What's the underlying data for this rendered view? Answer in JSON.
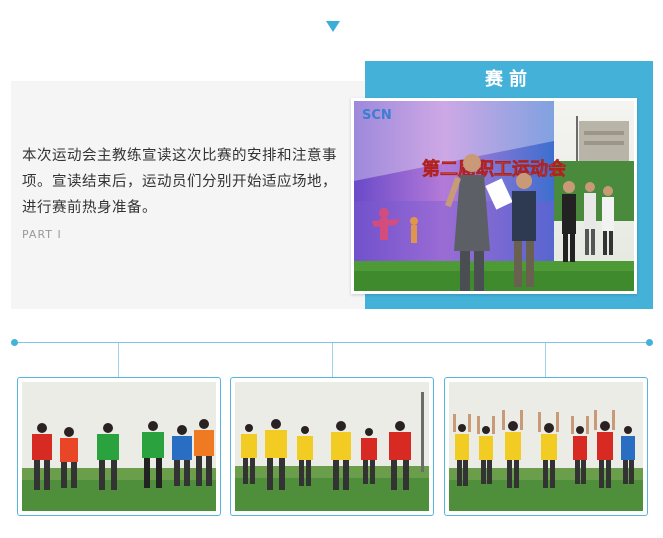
{
  "section": {
    "title": "赛前",
    "description": "本次运动会主教练宣读这次比赛的安排和注意事项。宣读结束后，运动员们分别开始适应场地，进行赛前热身准备。",
    "part_label": "PART I"
  },
  "main_photo": {
    "banner_logo": "SCN",
    "banner_text": "第二届职工运动会"
  },
  "colors": {
    "accent": "#44b2d8",
    "card_bg": "#f5f5f5",
    "timeline": "#7fc4e4"
  },
  "icons": [
    "down-triangle-icon"
  ]
}
